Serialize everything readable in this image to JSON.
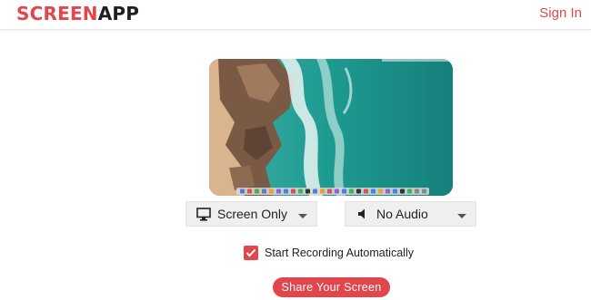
{
  "header": {
    "logo_part1": "SCREEN",
    "logo_part2": "APP",
    "signin_label": "Sign In"
  },
  "preview": {
    "description_icon": "desktop-preview-image"
  },
  "controls": {
    "screen_source": {
      "label": "Screen Only",
      "icon": "monitor-icon"
    },
    "audio_source": {
      "label": "No Audio",
      "icon": "speaker-icon"
    },
    "auto_record": {
      "label": "Start Recording Automatically",
      "checked": true
    }
  },
  "actions": {
    "share_label": "Share Your Screen"
  },
  "colors": {
    "accent": "#e0464c",
    "dropdown_bg": "#efefef"
  }
}
